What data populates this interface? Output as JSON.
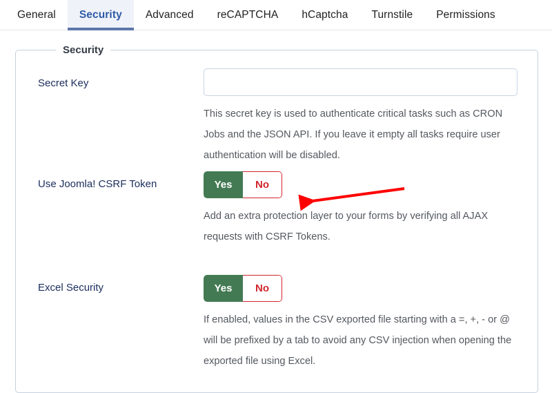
{
  "tabs": [
    {
      "label": "General",
      "active": false
    },
    {
      "label": "Security",
      "active": true
    },
    {
      "label": "Advanced",
      "active": false
    },
    {
      "label": "reCAPTCHA",
      "active": false
    },
    {
      "label": "hCaptcha",
      "active": false
    },
    {
      "label": "Turnstile",
      "active": false
    },
    {
      "label": "Permissions",
      "active": false
    }
  ],
  "panel": {
    "legend": "Security"
  },
  "fields": {
    "secret_key": {
      "label": "Secret Key",
      "value": "",
      "placeholder": "",
      "description": "This secret key is used to authenticate critical tasks such as CRON Jobs and the JSON API. If you leave it empty all tasks require user authentication will be disabled."
    },
    "csrf_token": {
      "label": "Use Joomla! CSRF Token",
      "yes_label": "Yes",
      "no_label": "No",
      "selected": "Yes",
      "description": "Add an extra protection layer to your forms by verifying all AJAX requests with CSRF Tokens."
    },
    "excel_security": {
      "label": "Excel Security",
      "yes_label": "Yes",
      "no_label": "No",
      "selected": "Yes",
      "description": "If enabled, values in the CSV exported file starting with a =, +, - or @ will be prefixed by a tab to avoid any CSV injection when opening the exported file using Excel."
    }
  },
  "annotation": {
    "arrow_color": "#fe0000",
    "points_at": "csrf-token-toggle"
  },
  "colors": {
    "tab_active_text": "#2e5aa8",
    "tab_active_underline": "#5d77a8",
    "tab_active_bg": "#eff2f8",
    "label_text": "#1b2d5c",
    "description_text": "#54585e",
    "toggle_yes_bg": "#447a53",
    "toggle_no_text": "#d0252b",
    "panel_border": "#c6d0de",
    "input_border": "#c6d3e2"
  }
}
